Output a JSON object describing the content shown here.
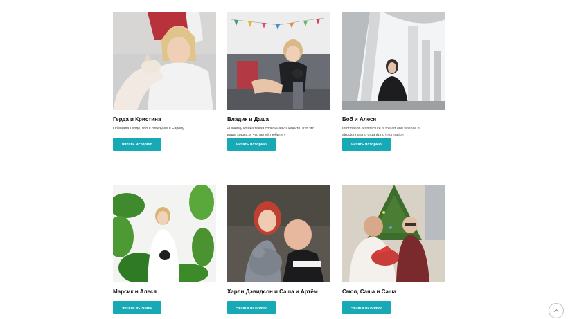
{
  "cards": [
    {
      "title": "Герда и Кристина",
      "description": "Обещала Герде, что я отвезу её в Европу",
      "button": "читать историю"
    },
    {
      "title": "Владик и Даша",
      "description": "«Почему кошка такая спокойная? Скажите, что это ваша кошка, и что вы её любите!»",
      "button": "читать историю"
    },
    {
      "title": "Боб и Алеся",
      "description": "Information architecture is the art and science of structuring and organizing information",
      "button": "читать историю"
    },
    {
      "title": "Марсик и Алеся",
      "description": "",
      "button": "читать историю"
    },
    {
      "title": "Харли Дэвидсон и Саша и Артём",
      "description": "",
      "button": "читать историю"
    },
    {
      "title": "Смол, Саша и Саша",
      "description": "",
      "button": "читать историю"
    }
  ],
  "scroll_top_icon": "chevron-up-icon",
  "colors": {
    "accent": "#17a9b6"
  }
}
